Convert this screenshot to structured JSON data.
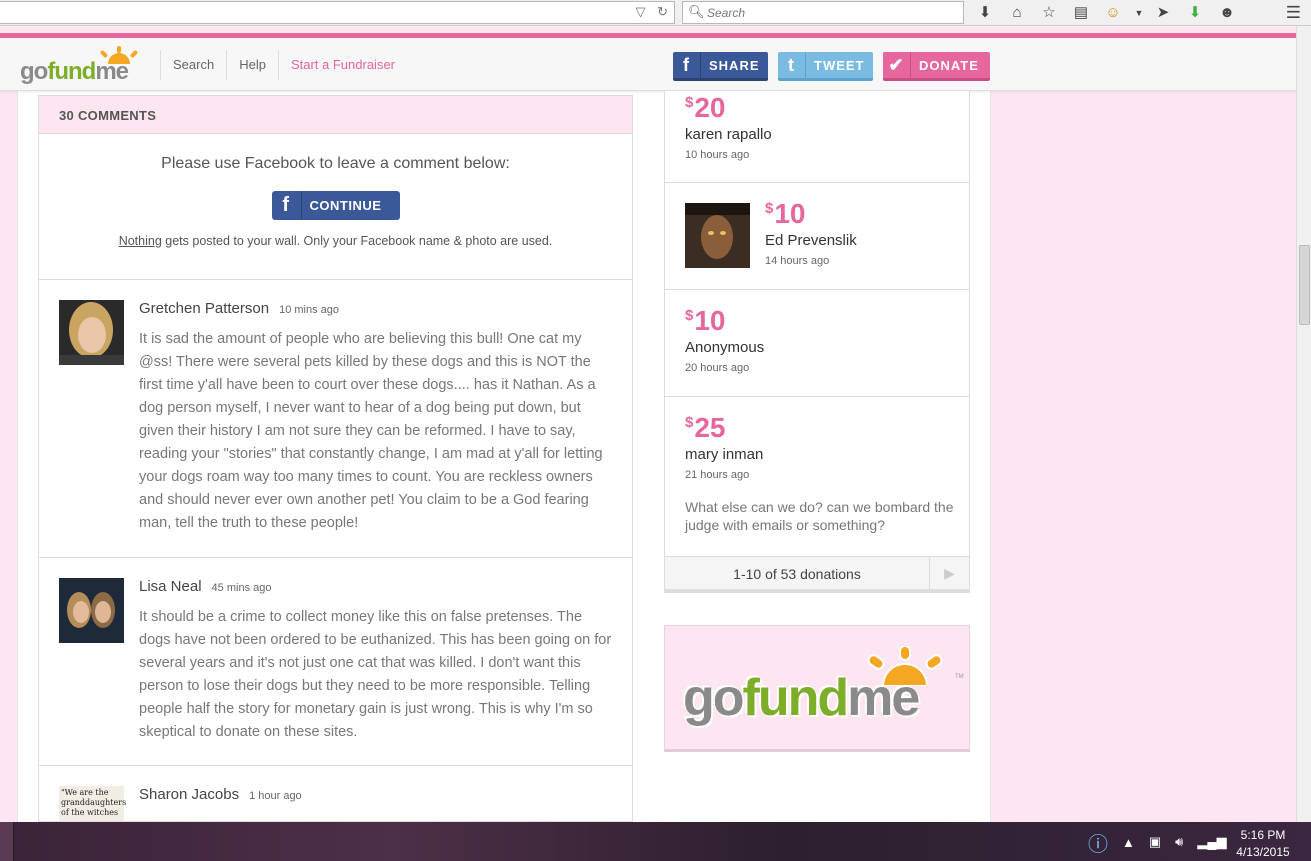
{
  "browser": {
    "search_placeholder": "Search",
    "icons": [
      "dropdown-arrow-icon",
      "reload-icon",
      "search-icon",
      "download-icon",
      "home-icon",
      "bookmark-star-icon",
      "reader-icon",
      "extension-face-icon",
      "send-icon",
      "green-download-icon",
      "chat-icon",
      "menu-icon"
    ]
  },
  "header": {
    "logo": {
      "part1": "go",
      "part2": "fund",
      "part3": "me"
    },
    "nav": [
      "Search",
      "Help",
      "Start a Fundraiser"
    ],
    "share_label": "SHARE",
    "tweet_label": "TWEET",
    "donate_label": "DONATE",
    "colors": {
      "pink": "#e5679d",
      "facebook": "#3b5998",
      "twitter": "#7bbbe1",
      "green": "#7dae2a"
    }
  },
  "comments": {
    "header": "30 COMMENTS",
    "fb_prompt": "Please use Facebook to leave a comment below:",
    "fb_button": "CONTINUE",
    "fb_note_link": "Nothing",
    "fb_note_rest": " gets posted to your wall. Only your Facebook name & photo are used.",
    "items": [
      {
        "name": "Gretchen Patterson",
        "time": "10 mins ago",
        "text": "It is sad the amount of people who are believing this bull! One cat my @ss! There were several pets killed by these dogs and this is NOT the first time y'all have been to court over these dogs.... has it Nathan. As a dog person myself, I never want to hear of a dog being put down, but given their history I am not sure they can be reformed. I have to say, reading your \"stories\" that constantly change, I am mad at y'all for letting your dogs roam way too many times to count. You are reckless owners and should never ever own another pet! You claim to be a God fearing man, tell the truth to these people!"
      },
      {
        "name": "Lisa Neal",
        "time": "45 mins ago",
        "text": "It should be a crime to collect money like this on false pretenses. The dogs have not been ordered to be euthanized. This has been going on for several years and it's not just one cat that was killed. I don't want this person to lose their dogs but they need to be more responsible. Telling people half the story for monetary gain is just wrong. This is why I'm so skeptical to donate on these sites."
      },
      {
        "name": "Sharon Jacobs",
        "time": "1 hour ago",
        "avatar_text": "\"We are the granddaughters of the witches",
        "text": ""
      }
    ]
  },
  "donations": {
    "currency": "$",
    "items": [
      {
        "amount": "20",
        "name": "karen rapallo",
        "time": "10 hours ago"
      },
      {
        "amount": "10",
        "name": "Ed Prevenslik",
        "time": "14 hours ago"
      },
      {
        "amount": "10",
        "name": "Anonymous",
        "time": "20 hours ago"
      },
      {
        "amount": "25",
        "name": "mary inman",
        "time": "21 hours ago",
        "message": "What else can we do? can we bombard the judge with emails or something?"
      }
    ],
    "pager": "1-10 of 53 donations"
  },
  "ad": {
    "part1": "go",
    "part2": "fund",
    "part3": "me",
    "tm": "TM"
  },
  "taskbar": {
    "time": "5:16 PM",
    "date": "4/13/2015"
  }
}
